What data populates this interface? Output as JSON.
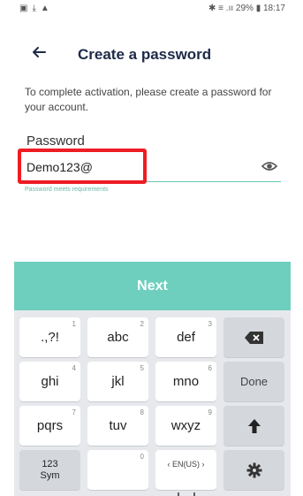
{
  "status_bar": {
    "left_icons": [
      "gallery-icon",
      "download-icon",
      "warning-icon"
    ],
    "right_text": "✱ ≡ .ıı 29% ▮ 18:17"
  },
  "header": {
    "title": "Create a password"
  },
  "instructions": "To complete activation, please create a password for your account.",
  "password": {
    "label": "Password",
    "value": "Demo123@",
    "hint": "Password meets requirements"
  },
  "next_label": "Next",
  "keyboard": {
    "rows": [
      [
        {
          "label": ".,?!",
          "num": "1"
        },
        {
          "label": "abc",
          "num": "2"
        },
        {
          "label": "def",
          "num": "3"
        },
        {
          "label": "",
          "icon": "backspace-icon"
        }
      ],
      [
        {
          "label": "ghi",
          "num": "4"
        },
        {
          "label": "jkl",
          "num": "5"
        },
        {
          "label": "mno",
          "num": "6"
        },
        {
          "label": "Done"
        }
      ],
      [
        {
          "label": "pqrs",
          "num": "7"
        },
        {
          "label": "tuv",
          "num": "8"
        },
        {
          "label": "wxyz",
          "num": "9"
        },
        {
          "label": "",
          "icon": "shift-arrow-icon"
        }
      ],
      [
        {
          "label": "123 Sym"
        },
        {
          "label": "",
          "num": "0"
        },
        {
          "label": "‹ EN(US) ›"
        },
        {
          "label": "",
          "icon": "settings-icon"
        }
      ]
    ]
  },
  "colors": {
    "accent": "#6ecfbe",
    "highlight": "#ee1c24",
    "title": "#1e2a48"
  }
}
